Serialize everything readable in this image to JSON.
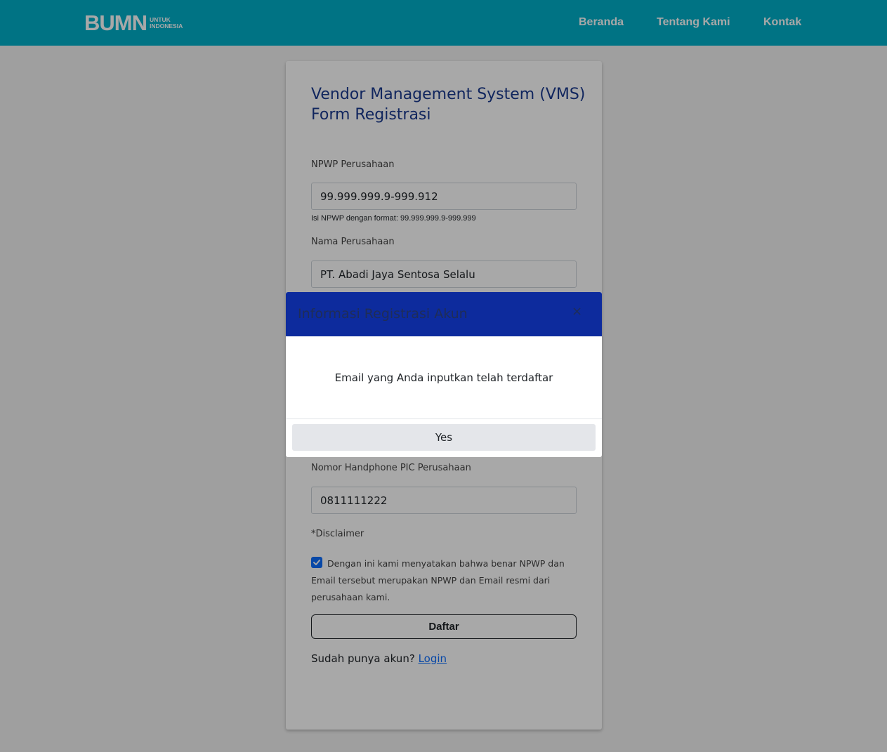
{
  "navbar": {
    "logo_mark": "BUMN",
    "logo_line1": "UNTUK",
    "logo_line2": "INDONESIA",
    "links": [
      "Beranda",
      "Tentang Kami",
      "Kontak"
    ],
    "background": "#00afc8"
  },
  "form": {
    "title_line1": "Vendor Management System (VMS)",
    "title_line2": "Form Registrasi",
    "npwp_label": "NPWP Perusahaan",
    "npwp_value": "99.999.999.9-999.912",
    "npwp_hint": "Isi NPWP dengan format: 99.999.999.9-999.999",
    "nama_label": "Nama Perusahaan",
    "nama_value": "PT. Abadi Jaya Sentosa Selalu",
    "hp_label": "Nomor Handphone PIC Perusahaan",
    "hp_value": "0811111222",
    "disclaimer_label": "*Disclaimer",
    "disclaimer_checked": true,
    "disclaimer_text": "Dengan ini kami menyatakan bahwa benar NPWP dan Email tersebut merupakan NPWP dan Email resmi dari perusahaan kami.",
    "submit_label": "Daftar",
    "login_prompt": "Sudah punya akun?",
    "login_link": "Login"
  },
  "modal": {
    "title": "Informasi Registrasi Akun",
    "close_label": "×",
    "message": "Email yang Anda inputkan telah terdaftar",
    "confirm_label": "Yes",
    "header_color": "#0d2b9d"
  }
}
